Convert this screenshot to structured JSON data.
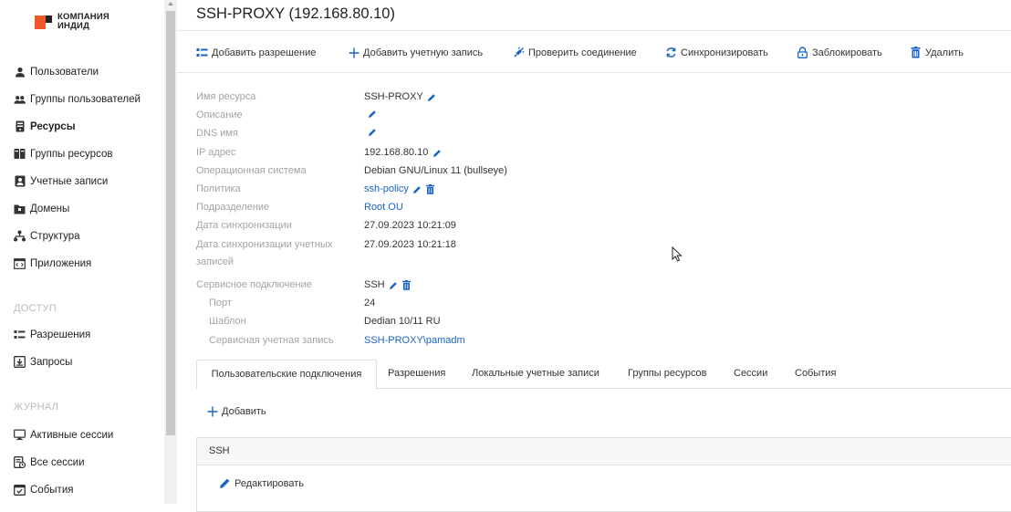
{
  "colors": {
    "brand": "#f05a28",
    "link": "#1a63c6",
    "label": "#a3a3a3"
  },
  "logo": {
    "line1": "КОМПАНИЯ",
    "line2": "ИНДИД",
    "icon": "company-logo"
  },
  "sidebar": {
    "items": [
      {
        "label": "Пользователи",
        "icon": "user-icon"
      },
      {
        "label": "Группы пользователей",
        "icon": "users-icon"
      },
      {
        "label": "Ресурсы",
        "icon": "server-icon",
        "active": true
      },
      {
        "label": "Группы ресурсов",
        "icon": "server-group-icon"
      },
      {
        "label": "Учетные записи",
        "icon": "account-icon"
      },
      {
        "label": "Домены",
        "icon": "folder-icon"
      },
      {
        "label": "Структура",
        "icon": "structure-icon"
      },
      {
        "label": "Приложения",
        "icon": "app-icon"
      }
    ],
    "section_access": "ДОСТУП",
    "access_items": [
      {
        "label": "Разрешения",
        "icon": "permission-icon"
      },
      {
        "label": "Запросы",
        "icon": "request-icon"
      }
    ],
    "section_journal": "ЖУРНАЛ",
    "journal_items": [
      {
        "label": "Активные сессии",
        "icon": "monitor-icon"
      },
      {
        "label": "Все сессии",
        "icon": "sessions-icon"
      },
      {
        "label": "События",
        "icon": "calendar-icon"
      }
    ]
  },
  "page": {
    "title": "SSH-PROXY (192.168.80.10)"
  },
  "toolbar": {
    "add_permission": "Добавить разрешение",
    "add_account": "Добавить учетную запись",
    "check_connection": "Проверить соединение",
    "sync": "Синхронизировать",
    "lock": "Заблокировать",
    "delete": "Удалить"
  },
  "properties": {
    "name": {
      "label": "Имя ресурса",
      "value": "SSH-PROXY"
    },
    "description": {
      "label": "Описание",
      "value": ""
    },
    "dns": {
      "label": "DNS имя",
      "value": ""
    },
    "ip": {
      "label": "IP адрес",
      "value": "192.168.80.10"
    },
    "os": {
      "label": "Операционная система",
      "value": "Debian GNU/Linux 11 (bullseye)"
    },
    "policy": {
      "label": "Политика",
      "value": "ssh-policy"
    },
    "ou": {
      "label": "Подразделение",
      "value": "Root OU"
    },
    "sync_date": {
      "label": "Дата синхронизации",
      "value": "27.09.2023 10:21:09"
    },
    "acc_sync_date": {
      "label_1": "Дата синхронизации учетных",
      "label_2": "записей",
      "value": "27.09.2023 10:21:18"
    },
    "service_conn": {
      "label": "Сервисное подключение",
      "value": "SSH"
    },
    "port": {
      "label": "Порт",
      "value": "24"
    },
    "template": {
      "label": "Шаблон",
      "value": "Dedian 10/11 RU"
    },
    "service_account": {
      "label": "Сервисная учетная запись",
      "value": "SSH-PROXY\\pamadm"
    }
  },
  "tabs": [
    {
      "label": "Пользовательские подключения",
      "active": true
    },
    {
      "label": "Разрешения"
    },
    {
      "label": "Локальные учетные записи"
    },
    {
      "label": "Группы ресурсов"
    },
    {
      "label": "Сессии"
    },
    {
      "label": "События"
    }
  ],
  "connections": {
    "add_label": "Добавить",
    "panel_title": "SSH",
    "edit_label": "Редактировать"
  }
}
